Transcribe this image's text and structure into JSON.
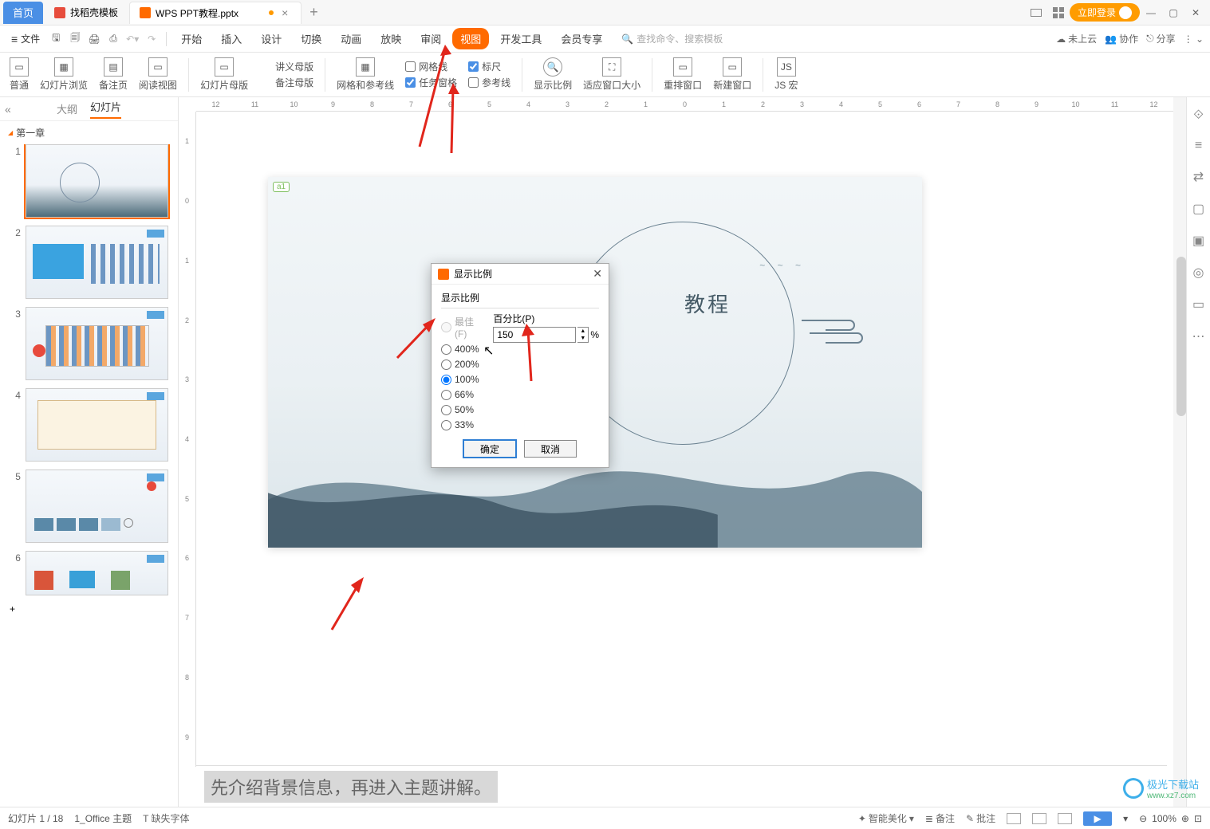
{
  "tabs": {
    "home": "首页",
    "template": "找稻壳模板",
    "doc": "WPS PPT教程.pptx"
  },
  "win": {
    "login": "立即登录"
  },
  "menu": {
    "file": "文件",
    "items": [
      "开始",
      "插入",
      "设计",
      "切换",
      "动画",
      "放映",
      "审阅",
      "视图",
      "开发工具",
      "会员专享"
    ],
    "active_index": 7,
    "search_ph": "查找命令、搜索模板",
    "right": {
      "cloud": "未上云",
      "coop": "协作",
      "share": "分享"
    }
  },
  "ribbon": {
    "b": {
      "normal": "普通",
      "browse": "幻灯片浏览",
      "notes": "备注页",
      "read": "阅读视图",
      "master": "幻灯片母版",
      "hand": "讲义母版",
      "notemaster": "备注母版",
      "gridref": "网格和参考线",
      "grid": "网格线",
      "ruler": "标尺",
      "task": "任务窗格",
      "ref": "参考线",
      "zoom": "显示比例",
      "fit": "适应窗口大小",
      "rearr": "重排窗口",
      "newwin": "新建窗口",
      "js": "JS 宏"
    }
  },
  "panel": {
    "outline": "大纲",
    "slides": "幻灯片",
    "section": "第一章"
  },
  "thumbs": {
    "count": 6
  },
  "canvas": {
    "title": "教程",
    "placeholder": "a1",
    "birds": "~ ~ ~"
  },
  "notes": {
    "text": "先介绍背景信息，再进入主题讲解。"
  },
  "status": {
    "page": "幻灯片 1 / 18",
    "theme": "1_Office 主题",
    "missing": "缺失字体",
    "smart": "智能美化",
    "notes": "备注",
    "comment": "批注",
    "zoom": "100%"
  },
  "dialog": {
    "title": "显示比例",
    "group": "显示比例",
    "opts": [
      "最佳(F)",
      "400%",
      "200%",
      "100%",
      "66%",
      "50%",
      "33%"
    ],
    "disabled_opt": 0,
    "checked_opt": 3,
    "pct_label": "百分比(P)",
    "pct_value": "150",
    "pct_suffix": "%",
    "ok": "确定",
    "cancel": "取消"
  },
  "ruler": {
    "h": [
      "12",
      "11",
      "10",
      "9",
      "8",
      "7",
      "6",
      "5",
      "4",
      "3",
      "2",
      "1",
      "0",
      "1",
      "2",
      "3",
      "4",
      "5",
      "6",
      "7",
      "8",
      "9",
      "10",
      "11",
      "12"
    ],
    "v": [
      "1",
      "0",
      "1",
      "2",
      "3",
      "4",
      "5",
      "6",
      "7",
      "8",
      "9"
    ]
  },
  "watermark": {
    "brand": "极光下载站",
    "url": "www.xz7.com"
  }
}
